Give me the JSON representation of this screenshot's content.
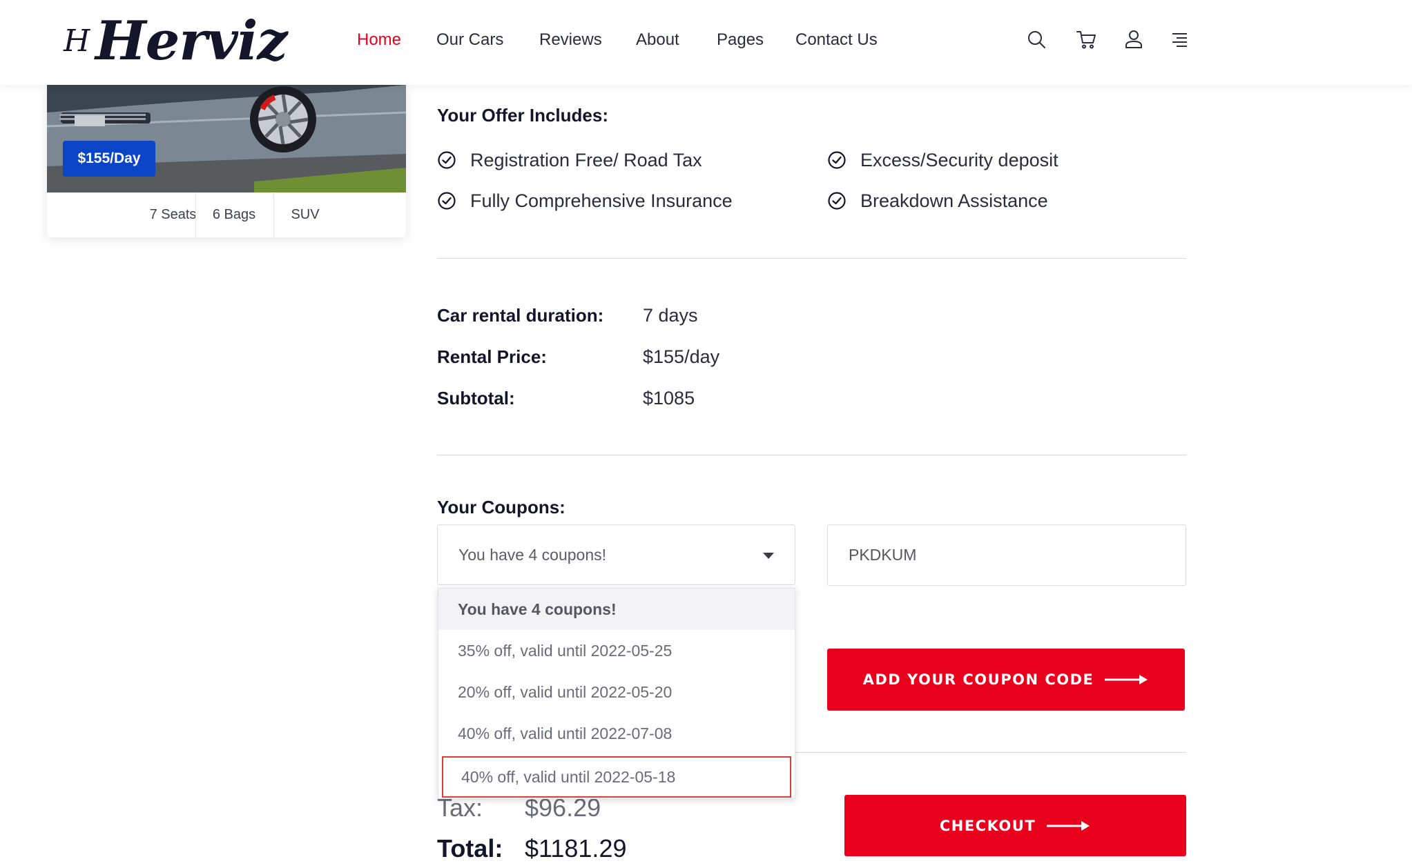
{
  "brand": {
    "mark": "H",
    "name": "Herviz"
  },
  "nav": {
    "items": [
      {
        "label": "Home",
        "active": true
      },
      {
        "label": "Our Cars",
        "active": false
      },
      {
        "label": "Reviews",
        "active": false
      },
      {
        "label": "About",
        "active": false
      },
      {
        "label": "Pages",
        "active": false
      },
      {
        "label": "Contact Us",
        "active": false
      }
    ],
    "icons": [
      "search-icon",
      "cart-icon",
      "user-icon",
      "menu-icon"
    ]
  },
  "car": {
    "price_badge": "$155/Day",
    "specs": [
      "7 Seats",
      "6 Bags",
      "SUV"
    ]
  },
  "offer": {
    "heading": "Your Offer Includes:",
    "items": [
      "Registration Free/ Road Tax",
      "Fully Comprehensive Insurance",
      "Excess/Security deposit",
      "Breakdown Assistance"
    ]
  },
  "summary": {
    "duration_label": "Car rental duration:",
    "duration_value": "7 days",
    "price_label": "Rental Price:",
    "price_value": "$155/day",
    "subtotal_label": "Subtotal:",
    "subtotal_value": "$1085"
  },
  "coupons": {
    "heading": "Your Coupons:",
    "selected": "You have 4 coupons!",
    "options": [
      "You have 4 coupons!",
      "35% off, valid until 2022-05-25",
      "20% off, valid until 2022-05-20",
      "40% off, valid until 2022-07-08",
      "40% off, valid until 2022-05-18"
    ],
    "code_value": "PKDKUM",
    "add_button": "ADD YOUR COUPON CODE"
  },
  "totals": {
    "tax_label": "Tax:",
    "tax_value": "$96.29",
    "total_label": "Total:",
    "total_value": "$1181.29"
  },
  "checkout": {
    "button": "CHECKOUT"
  },
  "colors": {
    "accent": "#e8001c",
    "badge": "#0b45c7",
    "text": "#14152b",
    "highlight_border": "#e53935"
  }
}
